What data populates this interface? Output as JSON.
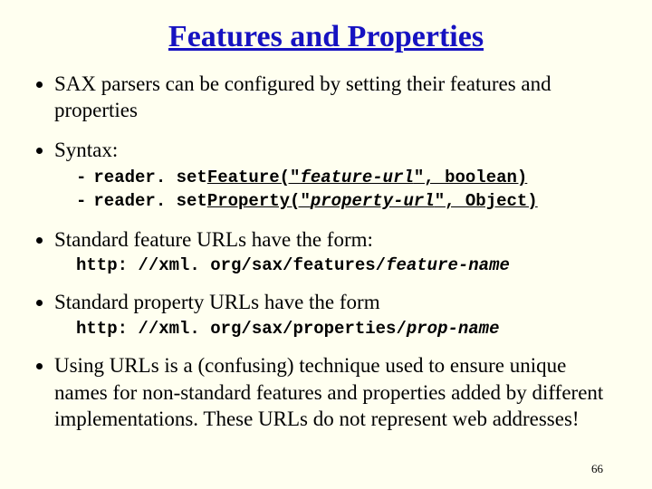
{
  "title": "Features and Properties",
  "bullets": {
    "b1": "SAX parsers can be configured by setting their features and properties",
    "b2": "Syntax:",
    "b3": "Standard feature URLs have the form:",
    "b4": "Standard property URLs have the form",
    "b5": "Using URLs is a (confusing) technique used to ensure unique names for non-standard features and properties added by different implementations. These URLs do not represent web addresses!"
  },
  "code": {
    "line1_pre": "reader. set",
    "line1_call": "Feature(\"",
    "line1_arg": "feature-url",
    "line1_post": "\", boolean)",
    "line2_pre": "reader. set",
    "line2_call": "Property(\"",
    "line2_arg": "property-url",
    "line2_post": "\", Object)"
  },
  "urls": {
    "feat_prefix": "http: //xml. org/sax/features/",
    "feat_name": "feature-name",
    "prop_prefix": "http: //xml. org/sax/properties/",
    "prop_name": "prop-name"
  },
  "page_number": "66"
}
